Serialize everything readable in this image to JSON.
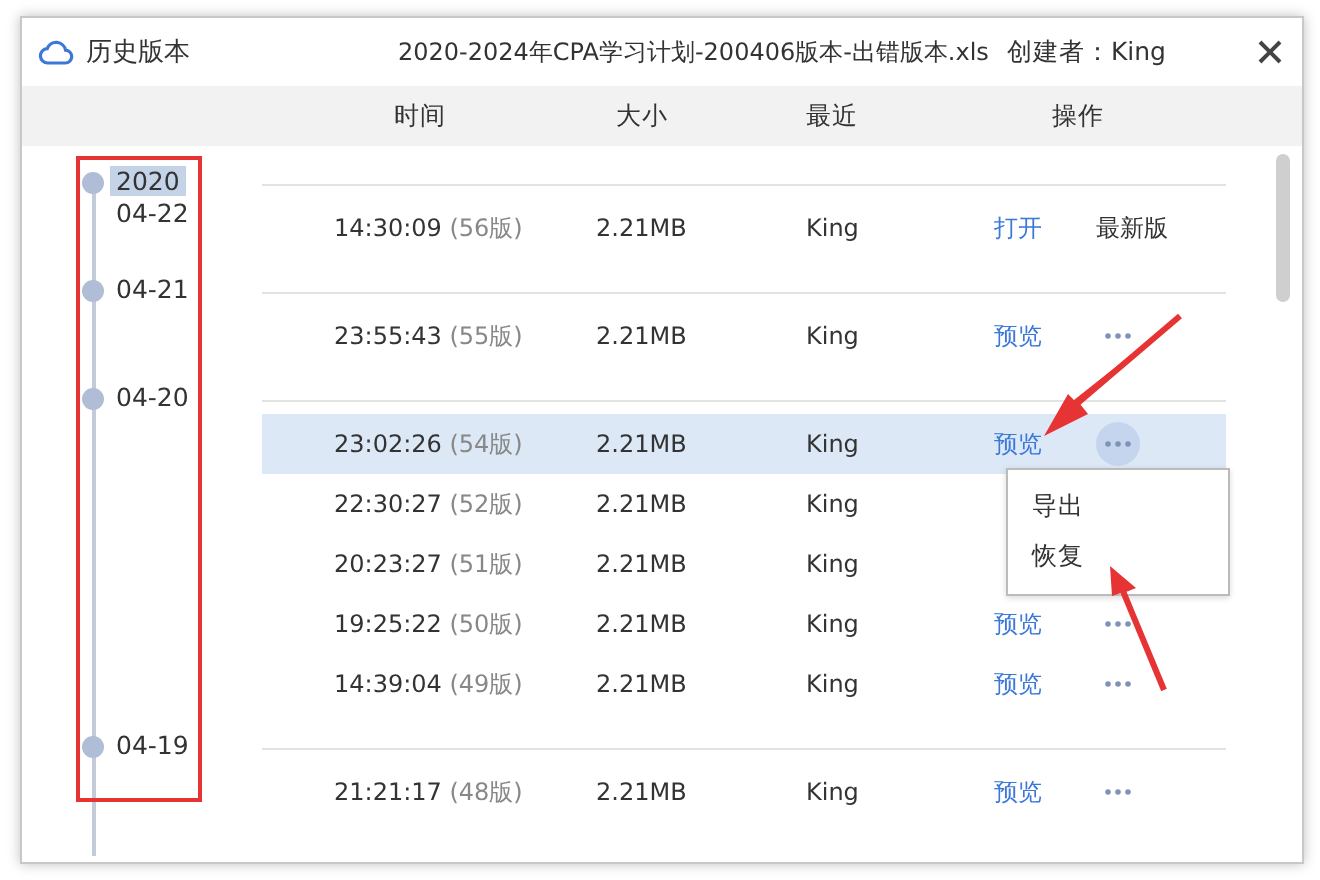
{
  "window": {
    "title": "历史版本",
    "file": "2020-2024年CPA学习计划-200406版本-出错版本.xls",
    "creator": "创建者：King"
  },
  "columns": [
    "时间",
    "大小",
    "最近",
    "操作"
  ],
  "groups": [
    {
      "year": "2020",
      "date": "04-22",
      "rows": [
        {
          "time": "14:30:09",
          "version": "(56版)",
          "size": "2.21MB",
          "recent": "King",
          "action": "打开",
          "kind": "latest",
          "tag": "最新版",
          "selected": false
        }
      ]
    },
    {
      "date": "04-21",
      "rows": [
        {
          "time": "23:55:43",
          "version": "(55版)",
          "size": "2.21MB",
          "recent": "King",
          "action": "预览",
          "kind": "more",
          "selected": false
        }
      ]
    },
    {
      "date": "04-20",
      "rows": [
        {
          "time": "23:02:26",
          "version": "(54版)",
          "size": "2.21MB",
          "recent": "King",
          "action": "预览",
          "kind": "more",
          "selected": true
        },
        {
          "time": "22:30:27",
          "version": "(52版)",
          "size": "2.21MB",
          "recent": "King",
          "kind": "covered",
          "selected": false
        },
        {
          "time": "20:23:27",
          "version": "(51版)",
          "size": "2.21MB",
          "recent": "King",
          "kind": "covered",
          "selected": false
        },
        {
          "time": "19:25:22",
          "version": "(50版)",
          "size": "2.21MB",
          "recent": "King",
          "action": "预览",
          "kind": "more",
          "selected": false
        },
        {
          "time": "14:39:04",
          "version": "(49版)",
          "size": "2.21MB",
          "recent": "King",
          "action": "预览",
          "kind": "more",
          "selected": false
        }
      ]
    },
    {
      "date": "04-19",
      "rows": [
        {
          "time": "21:21:17",
          "version": "(48版)",
          "size": "2.21MB",
          "recent": "King",
          "action": "预览",
          "kind": "more",
          "selected": false
        }
      ]
    }
  ],
  "menu": [
    "导出",
    "恢复"
  ]
}
